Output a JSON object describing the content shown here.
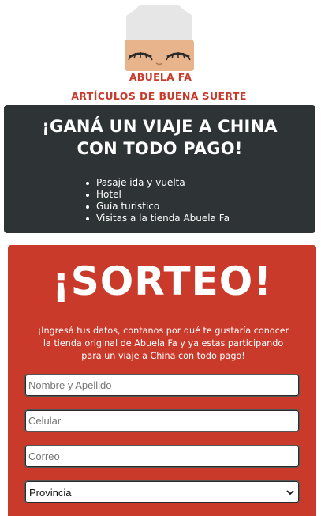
{
  "brand": {
    "name": "ABUELA FA",
    "logo_icon": "grandma-face-icon"
  },
  "tagline": "ARTÍCULOS DE BUENA SUERTE",
  "promo": {
    "title_line1": "¡GANÁ UN VIAJE A CHINA",
    "title_line2": "CON TODO PAGO!",
    "prizes": [
      "Pasaje ida y vuelta",
      "Hotel",
      "Guía turistico",
      "Visitas a la tienda Abuela Fa"
    ]
  },
  "raffle": {
    "title": "¡SORTEO!",
    "text_line1": "¡Ingresá tus datos, contanos por qué te gustaría conocer",
    "text_line2": "la tienda original de Abuela Fa y ya estas participando",
    "text_line3": "para un viaje a China con todo pago!"
  },
  "form": {
    "name_placeholder": "Nombre y Apellido",
    "phone_placeholder": "Celular",
    "email_placeholder": "Correo",
    "province_value": "Provincia",
    "province_arrow_icon": "chevron-down-icon"
  },
  "colors": {
    "brand_red": "#c93a2b",
    "dark_panel": "#2e3436",
    "white": "#ffffff"
  }
}
